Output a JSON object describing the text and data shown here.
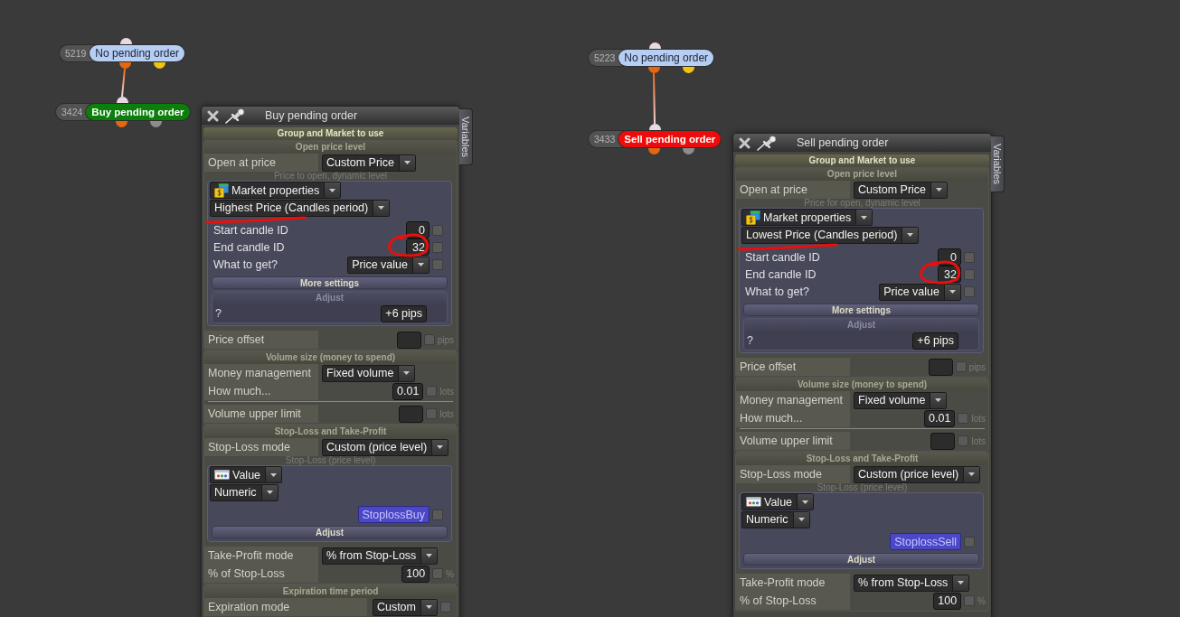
{
  "diagram": [
    {
      "number": "5219",
      "label": "No pending order",
      "kind": "condition",
      "color": "#b6cdf4",
      "children": [
        {
          "number": "3424",
          "label": "Buy pending order",
          "kind": "action",
          "color": "#0b7e0b"
        }
      ]
    },
    {
      "number": "5223",
      "label": "No pending order",
      "kind": "condition",
      "color": "#b6cdf4",
      "children": [
        {
          "number": "3433",
          "label": "Sell pending order",
          "kind": "action",
          "color": "#ee0b0b"
        }
      ]
    }
  ],
  "panels": [
    {
      "title": "Buy pending order",
      "side_tab": "Variables",
      "sections": [
        {
          "kind": "banner",
          "title": "Group and Market to use"
        },
        {
          "kind": "section",
          "title": "Open price level",
          "rows": [
            {
              "kind": "select",
              "label": "Open at price",
              "value": "Custom Price"
            },
            {
              "kind": "caption",
              "text": "Price to open, dynamic level"
            },
            {
              "kind": "group",
              "rows": [
                {
                  "kind": "market_select",
                  "value": "Market properties"
                },
                {
                  "kind": "select_only",
                  "value": "Highest Price (Candles period)",
                  "annotated": true
                },
                {
                  "kind": "number",
                  "label": "Start candle ID",
                  "value": "0",
                  "checked": false,
                  "annotated": false
                },
                {
                  "kind": "number",
                  "label": "End candle ID",
                  "value": "32",
                  "checked": false,
                  "annotated": true
                },
                {
                  "kind": "select_check",
                  "label": "What to get?",
                  "value": "Price value",
                  "checked": false
                },
                {
                  "kind": "bar",
                  "text": "More settings"
                },
                {
                  "kind": "adjust",
                  "title": "Adjust",
                  "label": "?",
                  "value": "+6 pips"
                }
              ]
            },
            {
              "kind": "number",
              "label": "Price offset",
              "unit": "pips",
              "checked": false
            }
          ]
        },
        {
          "kind": "section",
          "title": "Volume size (money to spend)",
          "rows": [
            {
              "kind": "select",
              "label": "Money management",
              "value": "Fixed volume"
            },
            {
              "kind": "number",
              "label": "How much...",
              "value": "0.01",
              "unit": "lots",
              "checked": false
            },
            {
              "kind": "divider"
            },
            {
              "kind": "number",
              "label": "Volume upper limit",
              "unit": "lots",
              "checked": false
            }
          ]
        },
        {
          "kind": "section",
          "title": "Stop-Loss and Take-Profit",
          "rows": [
            {
              "kind": "select",
              "label": "Stop-Loss mode",
              "value": "Custom (price level)"
            },
            {
              "kind": "caption",
              "text": "Stop-Loss (price level)"
            },
            {
              "kind": "group",
              "rows": [
                {
                  "kind": "value_select",
                  "value": "Value"
                },
                {
                  "kind": "select_only",
                  "value": "Numeric",
                  "annotated": false
                },
                {
                  "kind": "variable",
                  "value": "StoplossBuy",
                  "checked": false
                },
                {
                  "kind": "bar",
                  "text": "Adjust"
                }
              ]
            },
            {
              "kind": "select",
              "label": "Take-Profit mode",
              "value": "% from Stop-Loss"
            },
            {
              "kind": "number",
              "label": "% of Stop-Loss",
              "value": "100",
              "unit": "%",
              "checked": false
            }
          ]
        },
        {
          "kind": "section",
          "title": "Expiration time period",
          "rows": [
            {
              "kind": "select_check",
              "label": "Expiration mode",
              "value": "Custom",
              "checked": false
            }
          ]
        }
      ]
    },
    {
      "title": "Sell pending order",
      "side_tab": "Variables",
      "sections": [
        {
          "kind": "banner",
          "title": "Group and Market to use"
        },
        {
          "kind": "section",
          "title": "Open price level",
          "rows": [
            {
              "kind": "select",
              "label": "Open at price",
              "value": "Custom Price"
            },
            {
              "kind": "caption",
              "text": "Price for open, dynamic level"
            },
            {
              "kind": "group",
              "rows": [
                {
                  "kind": "market_select",
                  "value": "Market properties"
                },
                {
                  "kind": "select_only",
                  "value": "Lowest Price (Candles period)",
                  "annotated": true
                },
                {
                  "kind": "number",
                  "label": "Start candle ID",
                  "value": "0",
                  "checked": false,
                  "annotated": false
                },
                {
                  "kind": "number",
                  "label": "End candle ID",
                  "value": "32",
                  "checked": false,
                  "annotated": true
                },
                {
                  "kind": "select_check",
                  "label": "What to get?",
                  "value": "Price value",
                  "checked": false
                },
                {
                  "kind": "bar",
                  "text": "More settings"
                },
                {
                  "kind": "adjust",
                  "title": "Adjust",
                  "label": "?",
                  "value": "+6 pips"
                }
              ]
            },
            {
              "kind": "number",
              "label": "Price offset",
              "unit": "pips",
              "checked": false
            }
          ]
        },
        {
          "kind": "section",
          "title": "Volume size (money to spend)",
          "rows": [
            {
              "kind": "select",
              "label": "Money management",
              "value": "Fixed volume"
            },
            {
              "kind": "number",
              "label": "How much...",
              "value": "0.01",
              "unit": "lots",
              "checked": false
            },
            {
              "kind": "divider"
            },
            {
              "kind": "number",
              "label": "Volume upper limit",
              "unit": "lots",
              "checked": false
            }
          ]
        },
        {
          "kind": "section",
          "title": "Stop-Loss and Take-Profit",
          "rows": [
            {
              "kind": "select",
              "label": "Stop-Loss mode",
              "value": "Custom (price level)"
            },
            {
              "kind": "caption",
              "text": "Stop-Loss (price level)"
            },
            {
              "kind": "group",
              "rows": [
                {
                  "kind": "value_select",
                  "value": "Value"
                },
                {
                  "kind": "select_only",
                  "value": "Numeric",
                  "annotated": false
                },
                {
                  "kind": "variable",
                  "value": "StoplossSell",
                  "checked": false
                },
                {
                  "kind": "bar",
                  "text": "Adjust"
                }
              ]
            },
            {
              "kind": "select",
              "label": "Take-Profit mode",
              "value": "% from Stop-Loss"
            },
            {
              "kind": "number",
              "label": "% of Stop-Loss",
              "value": "100",
              "unit": "%",
              "checked": false
            }
          ]
        }
      ]
    }
  ]
}
